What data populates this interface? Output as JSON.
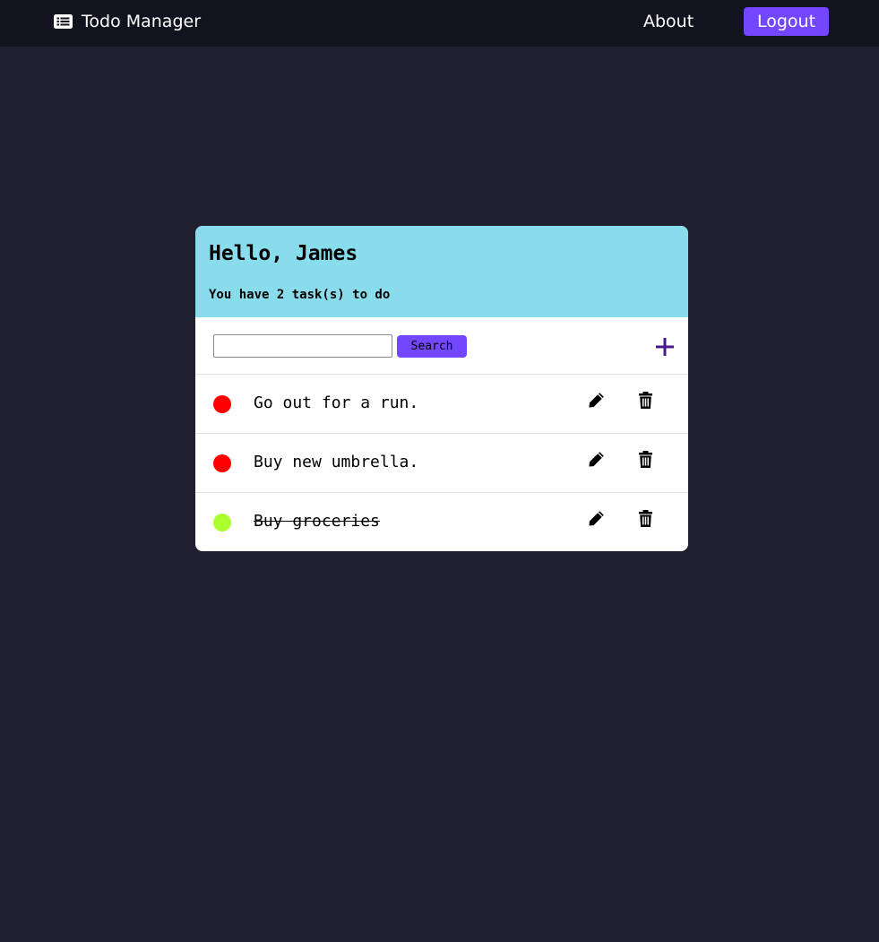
{
  "navbar": {
    "brand_icon": "list-icon",
    "brand_text": "Todo Manager",
    "about_label": "About",
    "logout_label": "Logout"
  },
  "header": {
    "greeting": "Hello, James",
    "task_count": "You have 2 task(s) to do"
  },
  "search": {
    "value": "",
    "placeholder": "",
    "button_label": "Search",
    "add_icon": "plus-icon"
  },
  "tasks": [
    {
      "text": "Go out for a run.",
      "status": "pending",
      "status_color": "#ff0000",
      "edit_icon": "pencil-icon",
      "delete_icon": "trash-icon"
    },
    {
      "text": "Buy new umbrella.",
      "status": "pending",
      "status_color": "#ff0000",
      "edit_icon": "pencil-icon",
      "delete_icon": "trash-icon"
    },
    {
      "text": "Buy groceries",
      "status": "done",
      "status_color": "#adff2f",
      "edit_icon": "pencil-icon",
      "delete_icon": "trash-icon"
    }
  ],
  "colors": {
    "page_bg": "#1f1f2f",
    "navbar_bg": "#131320",
    "accent": "#7347ff",
    "header_bg": "#89dcec",
    "add_icon": "#4b1a8a"
  }
}
